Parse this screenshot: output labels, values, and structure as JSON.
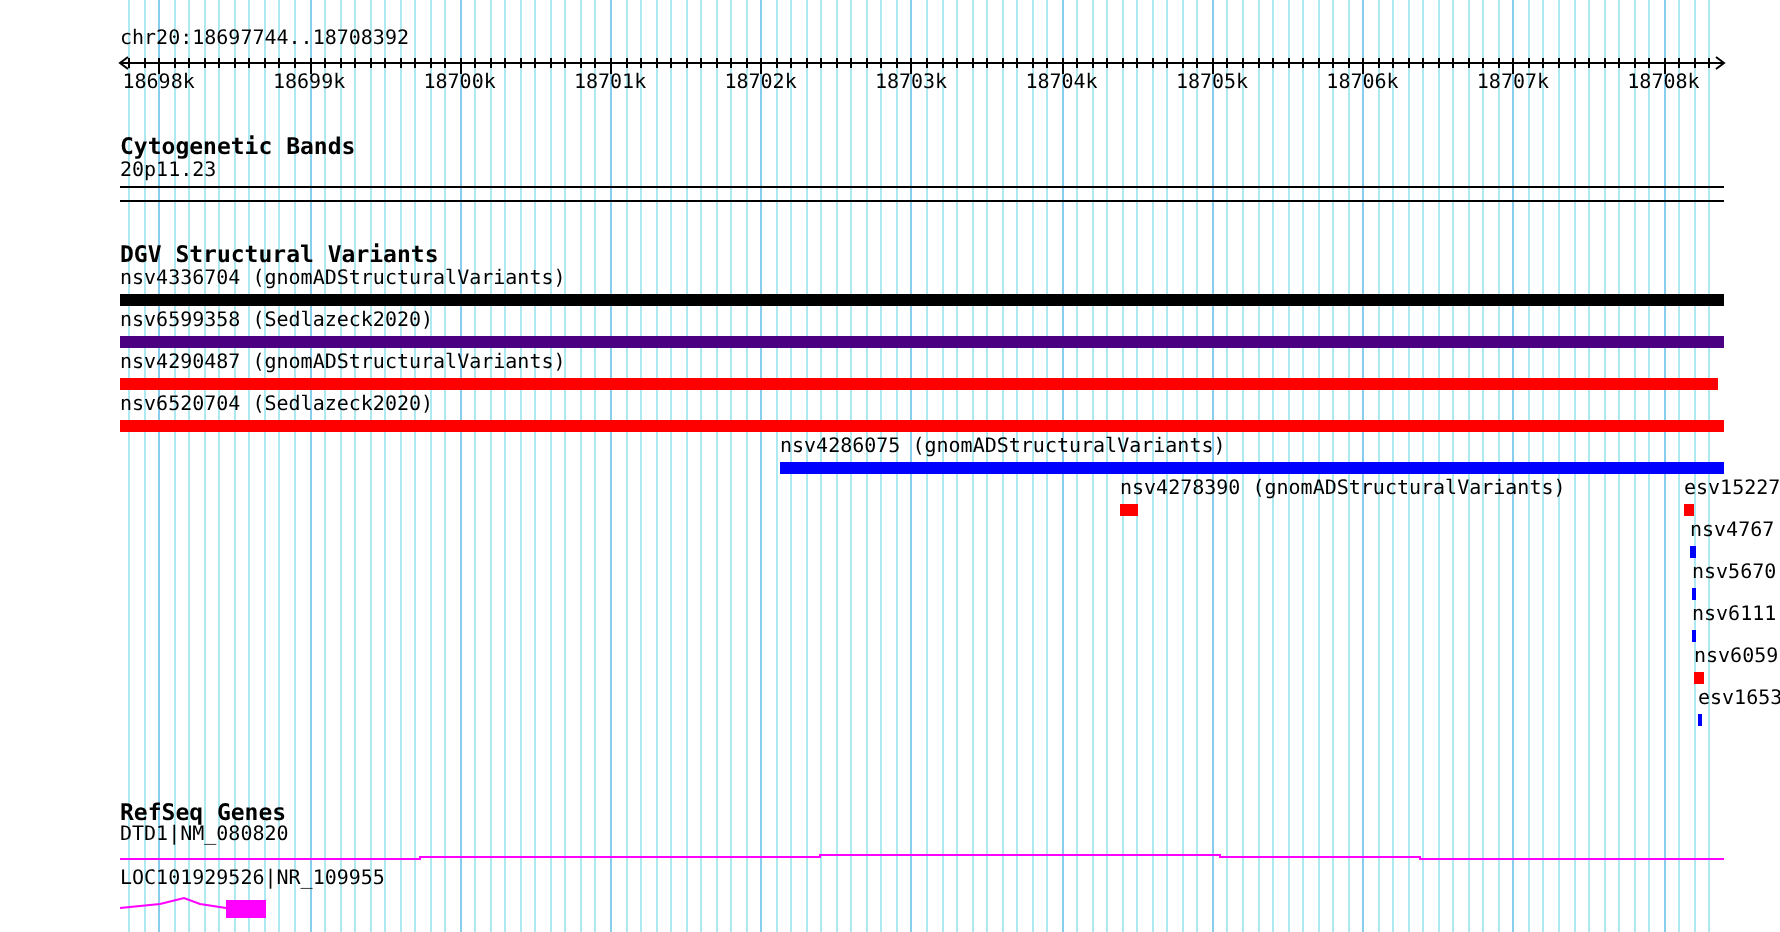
{
  "ruler": {
    "location": "chr20:18697744..18708392",
    "tick_labels": [
      "18698k",
      "18699k",
      "18700k",
      "18701k",
      "18702k",
      "18703k",
      "18704k",
      "18705k",
      "18706k",
      "18707k",
      "18708k"
    ]
  },
  "cytoband_track": {
    "title": "Cytogenetic Bands",
    "band": "20p11.23"
  },
  "dgv_track": {
    "title": "DGV Structural Variants",
    "features": [
      {
        "label": "nsv4336704 (gnomADStructuralVariants)",
        "color": "#000000"
      },
      {
        "label": "nsv6599358 (Sedlazeck2020)",
        "color": "#4b0082"
      },
      {
        "label": "nsv4290487 (gnomADStructuralVariants)",
        "color": "#ff0000"
      },
      {
        "label": "nsv6520704 (Sedlazeck2020)",
        "color": "#ff0000"
      },
      {
        "label": "nsv4286075 (gnomADStructuralVariants)",
        "color": "#0000ff"
      },
      {
        "label": "nsv4278390 (gnomADStructuralVariants)",
        "color": "#ff0000"
      },
      {
        "label": "esv15227",
        "color": "#ff0000"
      },
      {
        "label": "nsv4767",
        "color": "#0000ff"
      },
      {
        "label": "nsv5670",
        "color": "#0000ff"
      },
      {
        "label": "nsv6111",
        "color": "#0000ff"
      },
      {
        "label": "nsv6059",
        "color": "#ff0000"
      },
      {
        "label": "esv1653",
        "color": "#0000ff"
      }
    ]
  },
  "refseq_track": {
    "title": "RefSeq Genes",
    "genes": [
      {
        "label": "DTD1|NM_080820"
      },
      {
        "label": "LOC101929526|NR_109955"
      }
    ]
  }
}
